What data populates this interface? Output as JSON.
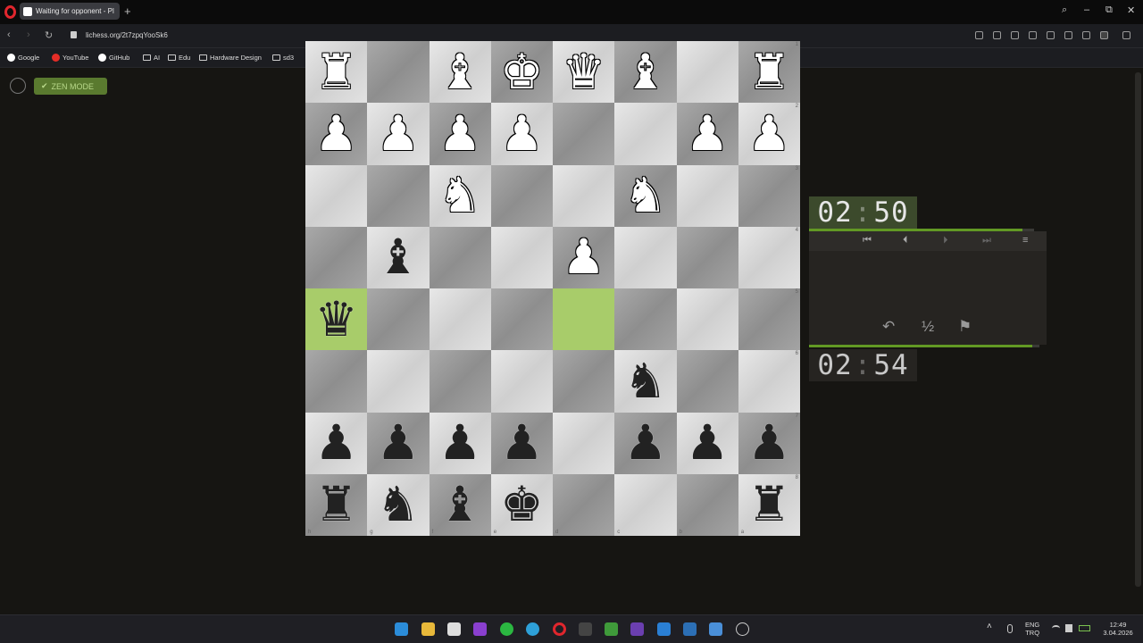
{
  "browser": {
    "tab_title": "Waiting for opponent - Pl",
    "new_tab_glyph": "+",
    "url": "lichess.org/2t7zpqYooSk6",
    "window_controls": [
      "⌕",
      "–",
      "⧉",
      "✕"
    ],
    "nav": {
      "back": "‹",
      "forward": "›",
      "reload": "↻"
    },
    "bookmarks": [
      {
        "label": "Google",
        "icon": "google-icon",
        "color": "#ffffff"
      },
      {
        "label": "YouTube",
        "icon": "youtube-icon",
        "color": "#e52d27"
      },
      {
        "label": "GitHub",
        "icon": "github-icon",
        "color": "#ffffff"
      },
      {
        "label": "AI",
        "icon": "folder-icon"
      },
      {
        "label": "Edu",
        "icon": "folder-icon"
      },
      {
        "label": "Hardware Design",
        "icon": "folder-icon"
      },
      {
        "label": "sd3",
        "icon": "folder-icon"
      }
    ]
  },
  "page": {
    "zen_mode_label": "ZEN MODE",
    "zen_check": "✔"
  },
  "board": {
    "rank_labels": [
      "1",
      "2",
      "3",
      "4",
      "5",
      "6",
      "7",
      "8"
    ],
    "file_labels": [
      "h",
      "g",
      "f",
      "e",
      "d",
      "c",
      "b",
      "a"
    ],
    "highlight_squares": [
      [
        4,
        0
      ],
      [
        4,
        4
      ]
    ],
    "rows": [
      [
        "wR",
        "",
        "wB",
        "wK",
        "wQ",
        "wB",
        "",
        "wR"
      ],
      [
        "wP",
        "wP",
        "wP",
        "wP",
        "",
        "",
        "wP",
        "wP"
      ],
      [
        "",
        "",
        "wN",
        "",
        "",
        "wN",
        "",
        ""
      ],
      [
        "",
        "bB",
        "",
        "",
        "wP",
        "",
        "",
        ""
      ],
      [
        "bQ",
        "",
        "",
        "",
        "",
        "",
        "",
        ""
      ],
      [
        "",
        "",
        "",
        "",
        "",
        "bN",
        "",
        ""
      ],
      [
        "bP",
        "bP",
        "bP",
        "bP",
        "",
        "bP",
        "bP",
        "bP"
      ],
      [
        "bR",
        "bN",
        "bB",
        "bK",
        "",
        "",
        "",
        "bR"
      ]
    ]
  },
  "pieces": {
    "wK": "♚",
    "wQ": "♛",
    "wR": "♜",
    "wB": "♝",
    "wN": "♞",
    "wP": "♟",
    "bK": "♚",
    "bQ": "♛",
    "bR": "♜",
    "bB": "♝",
    "bN": "♞",
    "bP": "♟"
  },
  "clocks": {
    "top": {
      "minutes": "02",
      "seconds": "50",
      "sep": ":",
      "progress": 0.95
    },
    "bottom": {
      "minutes": "02",
      "seconds": "54",
      "sep": ":",
      "progress": 0.97
    }
  },
  "controls": {
    "first": "⏮",
    "prev": "⏴",
    "next": "⏵",
    "last": "⏭",
    "menu": "≡",
    "takeback": "↶",
    "draw": "½",
    "resign": "⚑"
  },
  "taskbar": {
    "lang": "ENG",
    "layout": "TRQ",
    "time": "12:49",
    "date": "3.04.2026",
    "tray_up": "˄"
  },
  "colors": {
    "accent_green": "#629924",
    "zen_bg": "#5a7a2f",
    "opera_red": "#e0262d"
  }
}
